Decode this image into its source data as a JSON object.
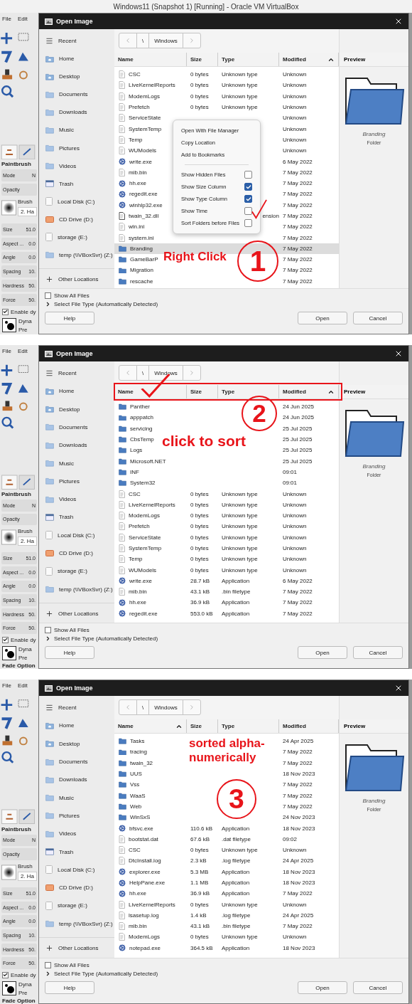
{
  "panels": [
    {
      "host_title": "Windows11 (Snapshot 1) [Running] - Oracle VM VirtualBox",
      "gimp": {
        "menu": [
          "File",
          "Edit"
        ],
        "tool_name": "Paintbrush",
        "options": [
          {
            "kind": "field",
            "label": "Mode",
            "value": "N"
          },
          {
            "kind": "field",
            "label": "Opacity"
          },
          {
            "kind": "brush",
            "label": "Brush",
            "value": "2. Ha"
          },
          {
            "kind": "field",
            "label": "Size",
            "value": "51.0"
          },
          {
            "kind": "field",
            "label": "Aspect ...",
            "value": "0.0"
          },
          {
            "kind": "field",
            "label": "Angle",
            "value": "0.0"
          },
          {
            "kind": "field",
            "label": "Spacing",
            "value": "10."
          },
          {
            "kind": "field",
            "label": "Hardness",
            "value": "50."
          },
          {
            "kind": "field",
            "label": "Force",
            "value": "50."
          }
        ],
        "dynamics": {
          "label": "Enable dy",
          "checked": true
        },
        "preset": [
          "Dyna",
          "Pre"
        ]
      },
      "dialog": {
        "title": "Open Image",
        "sidebar": [
          {
            "kind": "list",
            "label": "Recent"
          },
          {
            "kind": "home",
            "label": "Home"
          },
          {
            "kind": "home",
            "label": "Desktop"
          },
          {
            "kind": "folder",
            "label": "Documents"
          },
          {
            "kind": "folder",
            "label": "Downloads"
          },
          {
            "kind": "folder",
            "label": "Music"
          },
          {
            "kind": "folder",
            "label": "Pictures"
          },
          {
            "kind": "folder",
            "label": "Videos"
          },
          {
            "kind": "trash",
            "label": "Trash"
          },
          {
            "kind": "drive",
            "label": "Local Disk (C:)"
          },
          {
            "kind": "disc",
            "label": "CD Drive (D:)"
          },
          {
            "kind": "drive",
            "label": "storage (E:)"
          },
          {
            "kind": "folder",
            "label": "temp (\\\\VBoxSvr) (Z:)"
          }
        ],
        "other_locations": "Other Locations",
        "path": [
          "\\",
          "Windows"
        ],
        "columns": [
          {
            "label": "Name",
            "sorted": false
          },
          {
            "label": "Size",
            "sorted": false
          },
          {
            "label": "Type",
            "sorted": false
          },
          {
            "label": "Modified",
            "sorted": true
          }
        ],
        "rows": [
          {
            "kind": "file",
            "name": "CSC",
            "size": "0 bytes",
            "type": "Unknown type",
            "modified": "Unknown",
            "selected": false
          },
          {
            "kind": "file",
            "name": "LiveKernelReports",
            "size": "0 bytes",
            "type": "Unknown type",
            "modified": "Unknown",
            "selected": false
          },
          {
            "kind": "file",
            "name": "ModemLogs",
            "size": "0 bytes",
            "type": "Unknown type",
            "modified": "Unknown",
            "selected": false
          },
          {
            "kind": "file",
            "name": "Prefetch",
            "size": "0 bytes",
            "type": "Unknown type",
            "modified": "Unknown",
            "selected": false
          },
          {
            "kind": "file",
            "name": "ServiceState",
            "modified": "Unknown",
            "selected": false
          },
          {
            "kind": "file",
            "name": "SystemTemp",
            "modified": "Unknown",
            "selected": false
          },
          {
            "kind": "file",
            "name": "Temp",
            "modified": "Unknown",
            "selected": false
          },
          {
            "kind": "file",
            "name": "WUModels",
            "modified": "Unknown",
            "selected": false
          },
          {
            "kind": "exe",
            "name": "write.exe",
            "modified": "6 May 2022",
            "selected": false
          },
          {
            "kind": "file",
            "name": "mib.bin",
            "modified": "7 May 2022",
            "selected": false
          },
          {
            "kind": "exe",
            "name": "hh.exe",
            "modified": "7 May 2022",
            "selected": false
          },
          {
            "kind": "exe",
            "name": "regedit.exe",
            "modified": "7 May 2022",
            "selected": false
          },
          {
            "kind": "exe",
            "name": "winhlp32.exe",
            "modified": "7 May 2022",
            "selected": false
          },
          {
            "kind": "dll",
            "name": "twain_32.dll",
            "type_tail": "ension",
            "modified": "7 May 2022",
            "selected": false
          },
          {
            "kind": "file",
            "name": "win.ini",
            "modified": "7 May 2022",
            "selected": false
          },
          {
            "kind": "file",
            "name": "system.ini",
            "modified": "7 May 2022",
            "selected": false
          },
          {
            "kind": "folder",
            "name": "Branding",
            "modified": "7 May 2022",
            "selected": true
          },
          {
            "kind": "folder",
            "name": "GameBarP",
            "modified": "7 May 2022",
            "selected": false
          },
          {
            "kind": "folder",
            "name": "Migration",
            "modified": "7 May 2022",
            "selected": false
          },
          {
            "kind": "folder",
            "name": "rescache",
            "modified": "7 May 2022",
            "selected": false
          }
        ],
        "preview": {
          "header": "Preview",
          "name": "Branding",
          "type": "Folder"
        },
        "show_all_files": {
          "label": "Show All Files",
          "checked": false
        },
        "file_type": "Select File Type (Automatically Detected)",
        "buttons": [
          "Help",
          "Open",
          "Cancel"
        ]
      },
      "context_menu": [
        {
          "kind": "action",
          "label": "Open With File Manager"
        },
        {
          "kind": "action",
          "label": "Copy Location"
        },
        {
          "kind": "action",
          "label": "Add to Bookmarks"
        },
        {
          "kind": "separator"
        },
        {
          "kind": "toggle",
          "label": "Show Hidden Files",
          "checked": false
        },
        {
          "kind": "toggle",
          "label": "Show Size Column",
          "checked": true
        },
        {
          "kind": "toggle",
          "label": "Show Type Column",
          "checked": true
        },
        {
          "kind": "toggle",
          "label": "Show Time",
          "checked": false
        },
        {
          "kind": "toggle",
          "label": "Sort Folders before Files",
          "checked": false
        }
      ],
      "annotations": [
        {
          "kind": "tick"
        },
        {
          "kind": "label",
          "text": "Right Click"
        },
        {
          "kind": "step",
          "text": "1"
        }
      ]
    },
    {
      "gimp": {
        "menu": [
          "File",
          "Edit"
        ],
        "tool_name": "Paintbrush",
        "options": [
          {
            "kind": "field",
            "label": "Mode",
            "value": "N"
          },
          {
            "kind": "field",
            "label": "Opacity"
          },
          {
            "kind": "brush",
            "label": "Brush",
            "value": "2. Ha"
          },
          {
            "kind": "field",
            "label": "Size",
            "value": "51.0"
          },
          {
            "kind": "field",
            "label": "Aspect ...",
            "value": "0.0"
          },
          {
            "kind": "field",
            "label": "Angle",
            "value": "0.0"
          },
          {
            "kind": "field",
            "label": "Spacing",
            "value": "10."
          },
          {
            "kind": "field",
            "label": "Hardness",
            "value": "50."
          },
          {
            "kind": "field",
            "label": "Force",
            "value": "50."
          }
        ],
        "dynamics": {
          "label": "Enable dy",
          "checked": true
        },
        "preset": [
          "Dyna",
          "Pre"
        ],
        "fade": "Fade Option"
      },
      "dialog": {
        "title": "Open Image",
        "sidebar": [
          {
            "kind": "list",
            "label": "Recent"
          },
          {
            "kind": "home",
            "label": "Home"
          },
          {
            "kind": "home",
            "label": "Desktop"
          },
          {
            "kind": "folder",
            "label": "Documents"
          },
          {
            "kind": "folder",
            "label": "Downloads"
          },
          {
            "kind": "folder",
            "label": "Music"
          },
          {
            "kind": "folder",
            "label": "Pictures"
          },
          {
            "kind": "folder",
            "label": "Videos"
          },
          {
            "kind": "trash",
            "label": "Trash"
          },
          {
            "kind": "drive",
            "label": "Local Disk (C:)"
          },
          {
            "kind": "disc",
            "label": "CD Drive (D:)"
          },
          {
            "kind": "drive",
            "label": "storage (E:)"
          },
          {
            "kind": "folder",
            "label": "temp (\\\\VBoxSvr) (Z:)"
          }
        ],
        "other_locations": "Other Locations",
        "path": [
          "\\",
          "Windows"
        ],
        "columns": [
          {
            "label": "Name",
            "sorted": false
          },
          {
            "label": "Size",
            "sorted": false
          },
          {
            "label": "Type",
            "sorted": false
          },
          {
            "label": "Modified",
            "sorted": true
          }
        ],
        "rows": [
          {
            "kind": "folder",
            "name": "Panther",
            "modified": "24 Jun 2025",
            "selected": false
          },
          {
            "kind": "folder",
            "name": "apppatch",
            "modified": "24 Jun 2025",
            "selected": false
          },
          {
            "kind": "folder",
            "name": "servicing",
            "modified": "25 Jul 2025",
            "selected": false
          },
          {
            "kind": "folder",
            "name": "CbsTemp",
            "modified": "25 Jul 2025",
            "selected": false
          },
          {
            "kind": "folder",
            "name": "Logs",
            "modified": "25 Jul 2025",
            "selected": false
          },
          {
            "kind": "folder",
            "name": "Microsoft.NET",
            "modified": "25 Jul 2025",
            "selected": false
          },
          {
            "kind": "folder",
            "name": "INF",
            "modified": "09:01",
            "selected": false
          },
          {
            "kind": "folder",
            "name": "System32",
            "modified": "09:01",
            "selected": false
          },
          {
            "kind": "file",
            "name": "CSC",
            "size": "0 bytes",
            "type": "Unknown type",
            "modified": "Unknown",
            "selected": false
          },
          {
            "kind": "file",
            "name": "LiveKernelReports",
            "size": "0 bytes",
            "type": "Unknown type",
            "modified": "Unknown",
            "selected": false
          },
          {
            "kind": "file",
            "name": "ModemLogs",
            "size": "0 bytes",
            "type": "Unknown type",
            "modified": "Unknown",
            "selected": false
          },
          {
            "kind": "file",
            "name": "Prefetch",
            "size": "0 bytes",
            "type": "Unknown type",
            "modified": "Unknown",
            "selected": false
          },
          {
            "kind": "file",
            "name": "ServiceState",
            "size": "0 bytes",
            "type": "Unknown type",
            "modified": "Unknown",
            "selected": false
          },
          {
            "kind": "file",
            "name": "SystemTemp",
            "size": "0 bytes",
            "type": "Unknown type",
            "modified": "Unknown",
            "selected": false
          },
          {
            "kind": "file",
            "name": "Temp",
            "size": "0 bytes",
            "type": "Unknown type",
            "modified": "Unknown",
            "selected": false
          },
          {
            "kind": "file",
            "name": "WUModels",
            "size": "0 bytes",
            "type": "Unknown type",
            "modified": "Unknown",
            "selected": false
          },
          {
            "kind": "exe",
            "name": "write.exe",
            "size": "28.7 kB",
            "type": "Application",
            "modified": "6 May 2022",
            "selected": false
          },
          {
            "kind": "file",
            "name": "mib.bin",
            "size": "43.1 kB",
            "type": ".bin filetype",
            "modified": "7 May 2022",
            "selected": false
          },
          {
            "kind": "exe",
            "name": "hh.exe",
            "size": "36.9 kB",
            "type": "Application",
            "modified": "7 May 2022",
            "selected": false
          },
          {
            "kind": "exe",
            "name": "regedit.exe",
            "size": "553.0 kB",
            "type": "Application",
            "modified": "7 May 2022",
            "selected": false
          }
        ],
        "preview": {
          "header": "Preview",
          "name": "Branding",
          "type": "Folder"
        },
        "show_all_files": {
          "label": "Show All Files",
          "checked": false
        },
        "file_type": "Select File Type (Automatically Detected)",
        "buttons": [
          "Help",
          "Open",
          "Cancel"
        ]
      },
      "annotations": [
        {
          "kind": "frame"
        },
        {
          "kind": "tick"
        },
        {
          "kind": "label",
          "text": "click to sort"
        },
        {
          "kind": "step",
          "text": "2"
        }
      ]
    },
    {
      "gimp": {
        "menu": [
          "File",
          "Edit"
        ],
        "tool_name": "Paintbrush",
        "options": [
          {
            "kind": "field",
            "label": "Mode",
            "value": "N"
          },
          {
            "kind": "field",
            "label": "Opacity"
          },
          {
            "kind": "brush",
            "label": "Brush",
            "value": "2. Ha"
          },
          {
            "kind": "field",
            "label": "Size",
            "value": "51.0"
          },
          {
            "kind": "field",
            "label": "Aspect ...",
            "value": "0.0"
          },
          {
            "kind": "field",
            "label": "Angle",
            "value": "0.0"
          },
          {
            "kind": "field",
            "label": "Spacing",
            "value": "10."
          },
          {
            "kind": "field",
            "label": "Hardness",
            "value": "50."
          },
          {
            "kind": "field",
            "label": "Force",
            "value": "50."
          }
        ],
        "dynamics": {
          "label": "Enable dy",
          "checked": true
        },
        "preset": [
          "Dyna",
          "Pre"
        ],
        "fade": "Fade Option"
      },
      "dialog": {
        "title": "Open Image",
        "sidebar": [
          {
            "kind": "list",
            "label": "Recent"
          },
          {
            "kind": "home",
            "label": "Home"
          },
          {
            "kind": "home",
            "label": "Desktop"
          },
          {
            "kind": "folder",
            "label": "Documents"
          },
          {
            "kind": "folder",
            "label": "Downloads"
          },
          {
            "kind": "folder",
            "label": "Music"
          },
          {
            "kind": "folder",
            "label": "Pictures"
          },
          {
            "kind": "folder",
            "label": "Videos"
          },
          {
            "kind": "trash",
            "label": "Trash"
          },
          {
            "kind": "drive",
            "label": "Local Disk (C:)"
          },
          {
            "kind": "disc",
            "label": "CD Drive (D:)"
          },
          {
            "kind": "drive",
            "label": "storage (E:)"
          },
          {
            "kind": "folder",
            "label": "temp (\\\\VBoxSvr) (Z:)"
          }
        ],
        "other_locations": "Other Locations",
        "path": [
          "\\",
          "Windows"
        ],
        "columns": [
          {
            "label": "Name",
            "sorted": true
          },
          {
            "label": "Size",
            "sorted": false
          },
          {
            "label": "Type",
            "sorted": false
          },
          {
            "label": "Modified",
            "sorted": false
          }
        ],
        "rows": [
          {
            "kind": "folder",
            "name": "Tasks",
            "modified": "24 Apr 2025",
            "selected": false
          },
          {
            "kind": "folder",
            "name": "tracing",
            "modified": "7 May 2022",
            "selected": false
          },
          {
            "kind": "folder",
            "name": "twain_32",
            "modified": "7 May 2022",
            "selected": false
          },
          {
            "kind": "folder",
            "name": "UUS",
            "modified": "18 Nov 2023",
            "selected": false
          },
          {
            "kind": "folder",
            "name": "Vss",
            "modified": "7 May 2022",
            "selected": false
          },
          {
            "kind": "folder",
            "name": "WaaS",
            "modified": "7 May 2022",
            "selected": false
          },
          {
            "kind": "folder",
            "name": "Web",
            "modified": "7 May 2022",
            "selected": false
          },
          {
            "kind": "folder",
            "name": "WinSxS",
            "modified": "24 Nov 2023",
            "selected": false
          },
          {
            "kind": "exe",
            "name": "bfsvc.exe",
            "size": "110.6 kB",
            "type": "Application",
            "modified": "18 Nov 2023",
            "selected": false
          },
          {
            "kind": "file",
            "name": "bootstat.dat",
            "size": "67.6 kB",
            "type": ".dat filetype",
            "modified": "09:02",
            "selected": false
          },
          {
            "kind": "file",
            "name": "CSC",
            "size": "0 bytes",
            "type": "Unknown type",
            "modified": "Unknown",
            "selected": false
          },
          {
            "kind": "file",
            "name": "DtcInstall.log",
            "size": "2.3 kB",
            "type": ".log filetype",
            "modified": "24 Apr 2025",
            "selected": false
          },
          {
            "kind": "exe",
            "name": "explorer.exe",
            "size": "5.3 MB",
            "type": "Application",
            "modified": "18 Nov 2023",
            "selected": false
          },
          {
            "kind": "exe",
            "name": "HelpPane.exe",
            "size": "1.1 MB",
            "type": "Application",
            "modified": "18 Nov 2023",
            "selected": false
          },
          {
            "kind": "exe",
            "name": "hh.exe",
            "size": "36.9 kB",
            "type": "Application",
            "modified": "7 May 2022",
            "selected": false
          },
          {
            "kind": "file",
            "name": "LiveKernelReports",
            "size": "0 bytes",
            "type": "Unknown type",
            "modified": "Unknown",
            "selected": false
          },
          {
            "kind": "file",
            "name": "lsasetup.log",
            "size": "1.4 kB",
            "type": ".log filetype",
            "modified": "24 Apr 2025",
            "selected": false
          },
          {
            "kind": "file",
            "name": "mib.bin",
            "size": "43.1 kB",
            "type": ".bin filetype",
            "modified": "7 May 2022",
            "selected": false
          },
          {
            "kind": "file",
            "name": "ModemLogs",
            "size": "0 bytes",
            "type": "Unknown type",
            "modified": "Unknown",
            "selected": false
          },
          {
            "kind": "exe",
            "name": "notepad.exe",
            "size": "364.5 kB",
            "type": "Application",
            "modified": "18 Nov 2023",
            "selected": false
          }
        ],
        "preview": {
          "header": "Preview",
          "name": "Branding",
          "type": "Folder"
        },
        "show_all_files": {
          "label": "Show All Files",
          "checked": false
        },
        "file_type": "Select File Type (Automatically Detected)",
        "buttons": [
          "Help",
          "Open",
          "Cancel"
        ]
      },
      "annotations": [
        {
          "kind": "label",
          "text": "sorted alpha-numerically"
        },
        {
          "kind": "step",
          "text": "3"
        }
      ]
    }
  ]
}
